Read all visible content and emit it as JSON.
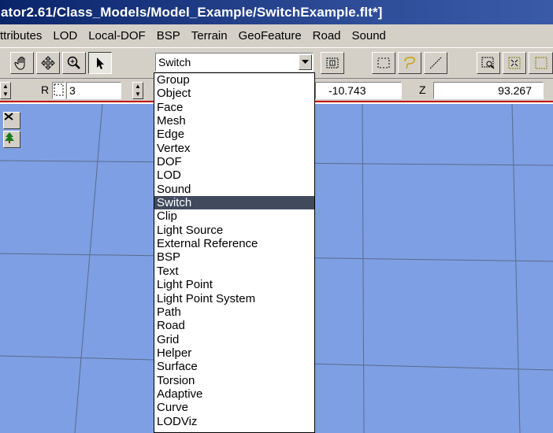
{
  "window": {
    "title": "ator2.61/Class_Models/Model_Example/SwitchExample.flt*]"
  },
  "menu": [
    {
      "label": "ttributes"
    },
    {
      "label": "LOD"
    },
    {
      "label": "Local-DOF"
    },
    {
      "label": "BSP"
    },
    {
      "label": "Terrain"
    },
    {
      "label": "GeoFeature"
    },
    {
      "label": "Road"
    },
    {
      "label": "Sound"
    }
  ],
  "toolbar": {
    "node_type_combo": {
      "value": "Switch"
    },
    "icons": [
      "hand-pan-icon",
      "move-cross-icon",
      "zoom-icon",
      "pointer-arrow-icon",
      "node-select-icon",
      "rect-select-icon",
      "lasso-select-icon",
      "line-select-icon",
      "zoom-box-icon",
      "fit-view-icon"
    ]
  },
  "coords": {
    "r_label": "R",
    "r_value": "3",
    "y_value": "-10.743",
    "z_label": "Z",
    "z_value": "93.267"
  },
  "dropdown": {
    "selected": "Switch",
    "items": [
      "Group",
      "Object",
      "Face",
      "Mesh",
      "Edge",
      "Vertex",
      "DOF",
      "LOD",
      "Sound",
      "Switch",
      "Clip",
      "Light Source",
      "External Reference",
      "BSP",
      "Text",
      "Light Point",
      "Light Point System",
      "Path",
      "Road",
      "Grid",
      "Helper",
      "Surface",
      "Torsion",
      "Adaptive",
      "Curve",
      "LODViz"
    ]
  },
  "colors": {
    "viewport_bg": "#7e9fe3",
    "grid_line": "#5a6a8a",
    "selection_bg": "#404a5c",
    "title_bg": "#0a246a"
  }
}
